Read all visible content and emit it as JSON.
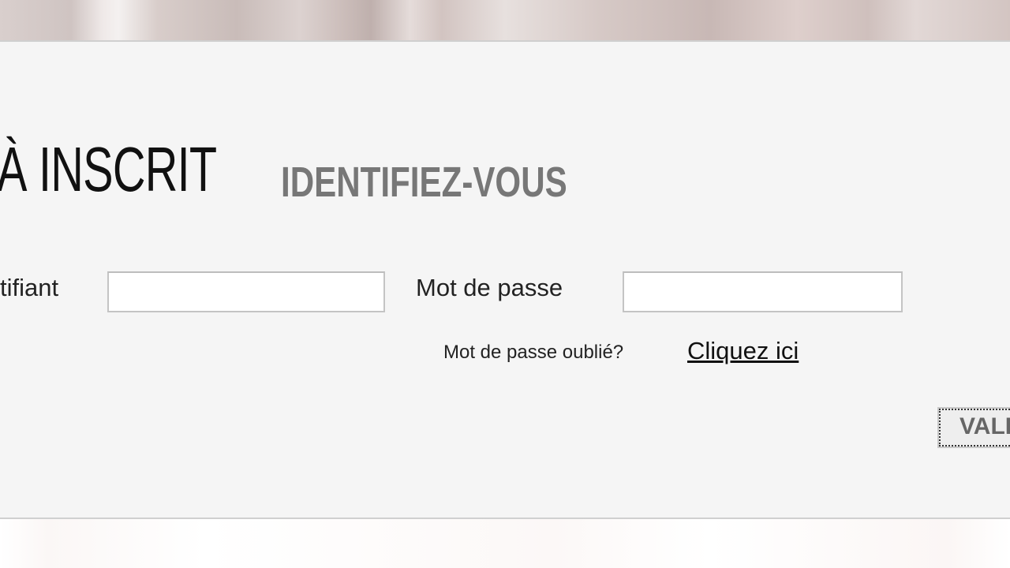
{
  "heading": {
    "main": "À INSCRIT",
    "sub": "IDENTIFIEZ-VOUS"
  },
  "form": {
    "identifier_label": "tifiant",
    "identifier_value": "",
    "password_label": "Mot de passe",
    "password_value": "",
    "forgot_text": "Mot de passe oublié?",
    "forgot_link": "Cliquez ici",
    "validate_label": "VALI"
  },
  "colors": {
    "panel_background": "#f5f5f5",
    "heading_main": "#111111",
    "heading_sub": "#777777"
  }
}
